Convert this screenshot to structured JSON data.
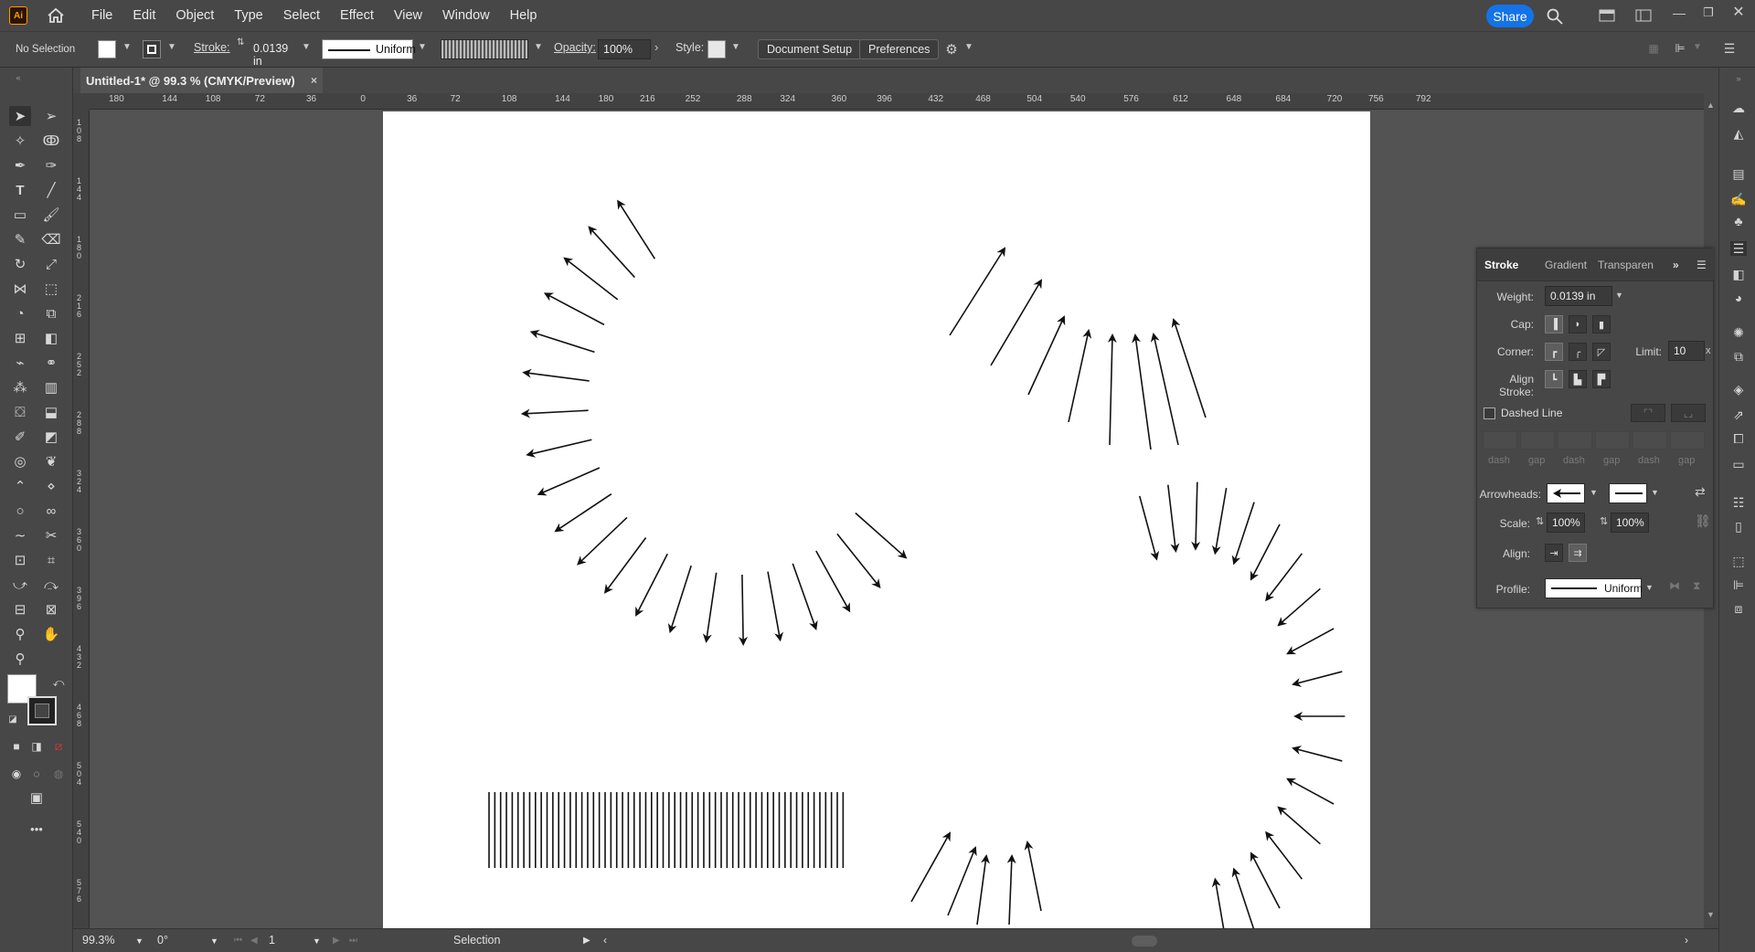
{
  "menubar": {
    "logo_text": "Ai",
    "items": [
      "File",
      "Edit",
      "Object",
      "Type",
      "Select",
      "Effect",
      "View",
      "Window",
      "Help"
    ],
    "share_label": "Share"
  },
  "control": {
    "selection_label": "No Selection",
    "stroke_label": "Stroke:",
    "stroke_value": "0.0139 in",
    "profile_label": "Uniform",
    "opacity_label": "Opacity:",
    "opacity_value": "100%",
    "style_label": "Style:",
    "document_setup": "Document Setup",
    "preferences": "Preferences"
  },
  "document": {
    "tab_title": "Untitled-1* @ 99.3 % (CMYK/Preview)",
    "close_glyph": "×"
  },
  "ruler": {
    "horizontal": [
      "180",
      "144",
      "108",
      "72",
      "36",
      "0",
      "36",
      "72",
      "108",
      "144",
      "180",
      "216",
      "252",
      "288",
      "324",
      "360",
      "396",
      "432",
      "468",
      "504",
      "540",
      "576",
      "612",
      "648",
      "684",
      "720",
      "756",
      "792"
    ],
    "vertical": [
      "108",
      "144",
      "180",
      "216",
      "252",
      "288",
      "324",
      "360",
      "396",
      "432",
      "468",
      "504",
      "540",
      "576"
    ]
  },
  "status": {
    "zoom": "99.3%",
    "rotation": "0°",
    "artboard": "1",
    "tool": "Selection"
  },
  "stroke_panel": {
    "tabs": [
      "Stroke",
      "Gradient",
      "Transparen"
    ],
    "weight_label": "Weight:",
    "weight_value": "0.0139 in",
    "cap_label": "Cap:",
    "corner_label": "Corner:",
    "limit_label": "Limit:",
    "limit_value": "10",
    "limit_unit": "x",
    "align_stroke_label": "Align Stroke:",
    "dashed_label": "Dashed Line",
    "dash_labels": [
      "dash",
      "gap",
      "dash",
      "gap",
      "dash",
      "gap"
    ],
    "arrowheads_label": "Arrowheads:",
    "scale_label": "Scale:",
    "scale_start": "100%",
    "scale_end": "100%",
    "align_label": "Align:",
    "profile_label": "Profile:",
    "profile_value": "Uniform"
  },
  "colors": {
    "accent": "#1473e6",
    "chrome": "#474747",
    "canvas": "#535353",
    "logo": "#ff9a00"
  }
}
